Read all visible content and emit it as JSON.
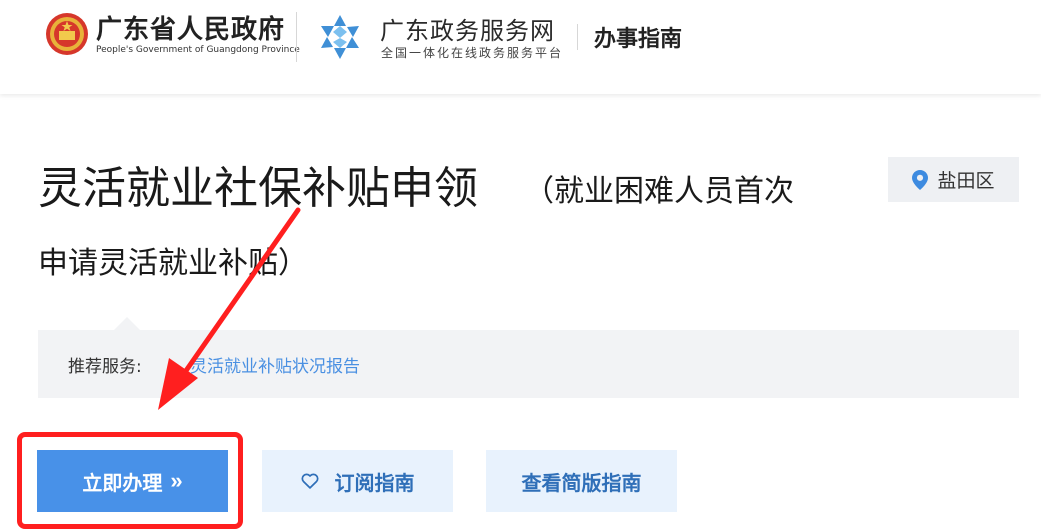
{
  "header": {
    "gov_name": "广东省人民政府",
    "gov_name_en": "People's Government of Guangdong Province",
    "service_name": "广东政务服务网",
    "service_subtitle": "全国一体化在线政务服务平台",
    "section_title": "办事指南"
  },
  "item": {
    "title": "灵活就业社保补贴申领",
    "subtitle_line1": "（就业困难人员首次",
    "subtitle_line2": "申请灵活就业补贴）",
    "region": "盐田区"
  },
  "recommend": {
    "label": "推荐服务:",
    "link": "灵活就业补贴状况报告"
  },
  "actions": {
    "apply": "立即办理",
    "apply_chevron": "»",
    "subscribe": "订阅指南",
    "simple_guide": "查看简版指南"
  },
  "colors": {
    "accent": "#4891e8",
    "annotation": "#ff1f1f",
    "link": "#4a90e2"
  }
}
